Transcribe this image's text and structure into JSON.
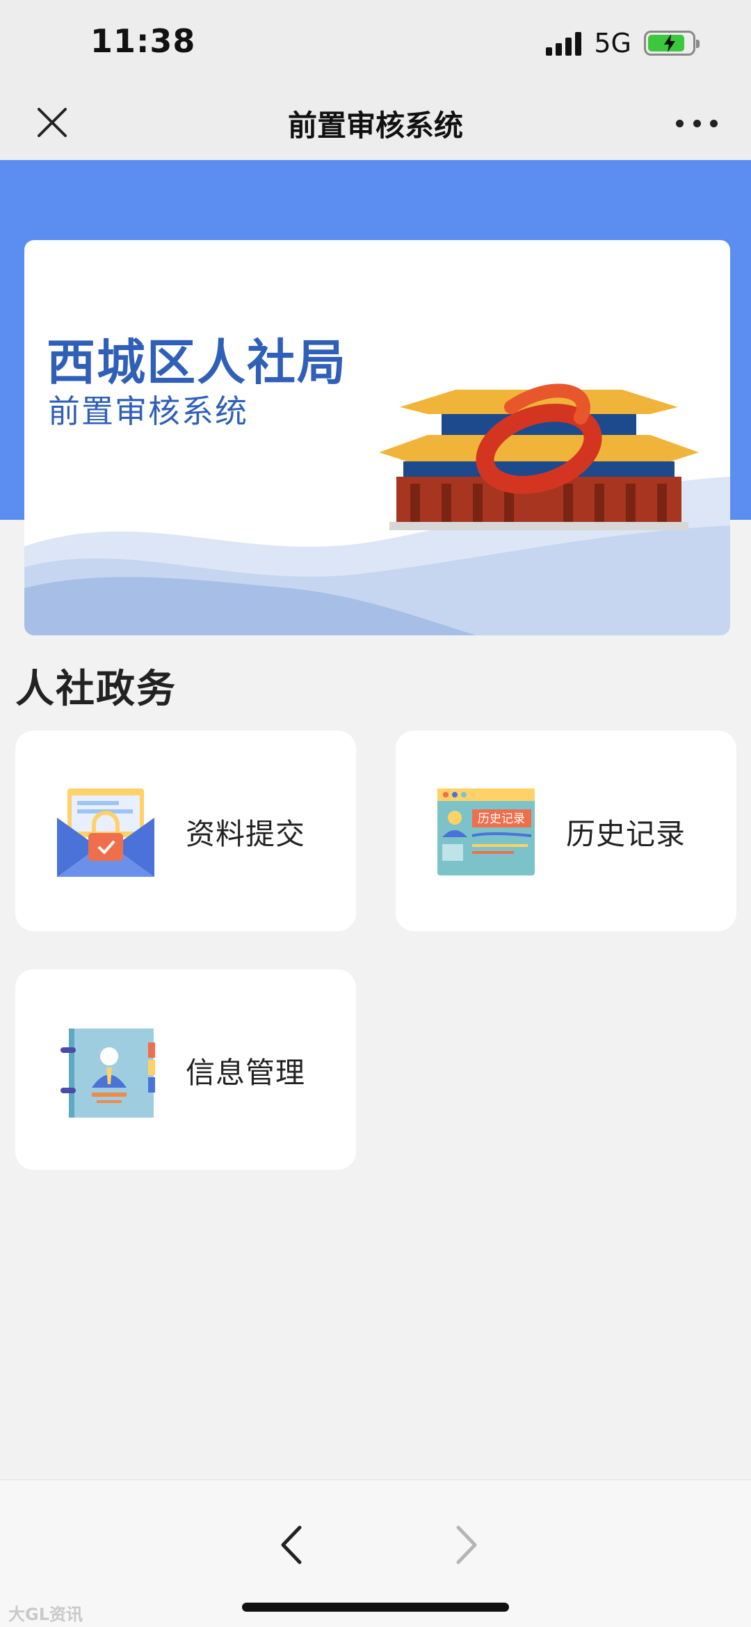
{
  "status": {
    "time": "11:38",
    "network": "5G",
    "battery_level": 0.85
  },
  "nav": {
    "title": "前置审核系统",
    "close_icon": "close-icon",
    "more_icon": "more-dots-icon"
  },
  "banner": {
    "title": "西城区人社局",
    "subtitle": "前置审核系统"
  },
  "section": {
    "title": "人社政务"
  },
  "cards": [
    {
      "label": "资料提交",
      "icon": "envelope-lock-icon"
    },
    {
      "label": "历史记录",
      "icon": "history-record-icon",
      "icon_text": "历史记录"
    },
    {
      "label": "信息管理",
      "icon": "contact-book-icon"
    }
  ],
  "bottom_nav": {
    "back_icon": "chevron-left-icon",
    "forward_icon": "chevron-right-icon"
  },
  "watermark": "大GL资讯",
  "colors": {
    "accent_blue": "#5b8ef0",
    "banner_text": "#2f5fb8",
    "battery_green": "#3cc83c"
  }
}
